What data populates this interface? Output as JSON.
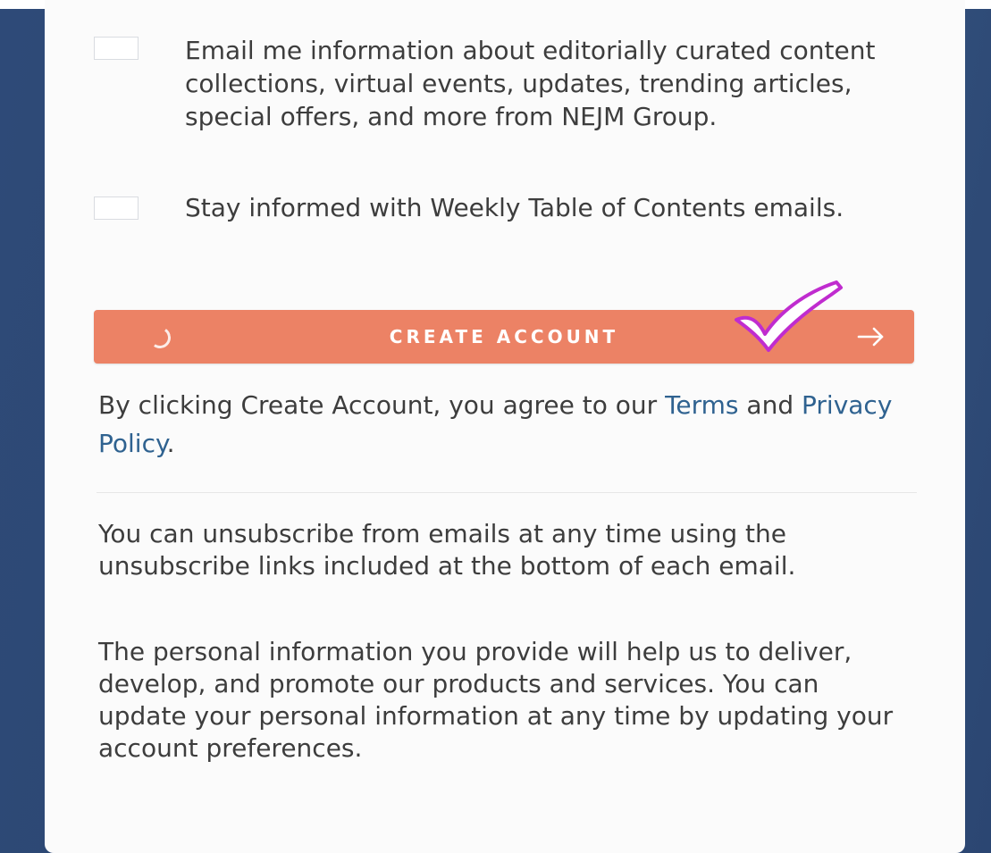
{
  "options": [
    {
      "label": "Email me information about editorially curated content collections, virtual events, updates, trending articles, special offers, and more from NEJM Group.",
      "checked": false
    },
    {
      "label": "Stay informed with Weekly Table of Contents emails.",
      "checked": false
    }
  ],
  "create_button": {
    "label": "CREATE ACCOUNT",
    "color": "#ec8265",
    "left_icon": "spinner-icon",
    "right_icon": "arrow-right-icon"
  },
  "annotation": {
    "icon": "check-mark-icon",
    "color": "#c02ccf"
  },
  "agreement": {
    "prefix": "By clicking Create Account, you agree to our ",
    "terms_link": "Terms",
    "middle": " and ",
    "privacy_link": "Privacy Policy",
    "suffix": ".",
    "link_color": "#2f6290"
  },
  "info": {
    "unsubscribe": "You can unsubscribe from emails at any time using the unsubscribe links included at the bottom of each email.",
    "personal": "The personal information you provide will help us to deliver, develop, and promote our products and services. You can update your personal information at any time by updating your account preferences."
  }
}
